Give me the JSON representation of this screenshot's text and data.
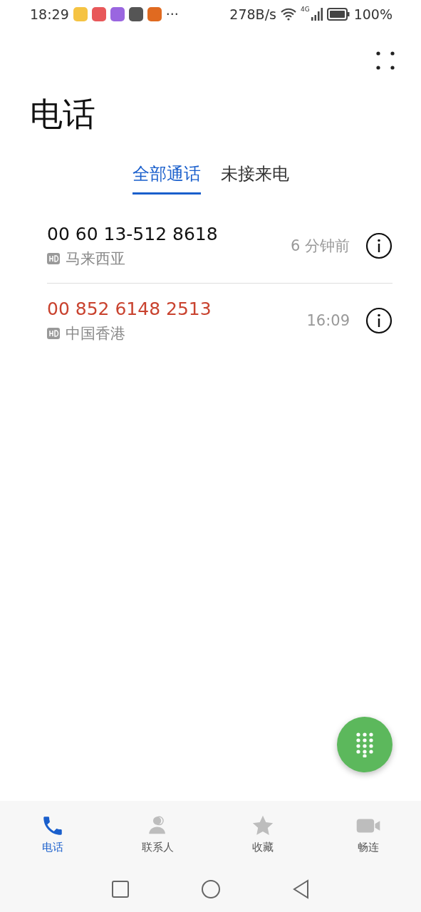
{
  "status_bar": {
    "time": "18:29",
    "notifications": [
      {
        "color": "#f5c343"
      },
      {
        "color": "#e8585a"
      },
      {
        "color": "#9a66e0"
      },
      {
        "color": "#555555"
      },
      {
        "color": "#e06a20"
      }
    ],
    "more": "···",
    "speed": "278B/s",
    "network": "4G",
    "battery": "100%"
  },
  "title": "电话",
  "tabs": [
    {
      "label": "全部通话",
      "selected": true
    },
    {
      "label": "未接来电",
      "selected": false
    }
  ],
  "calls": [
    {
      "number": "00 60 13-512 8618",
      "location": "马来西亚",
      "time": "6 分钟前",
      "missed": false
    },
    {
      "number": "00 852 6148 2513",
      "location": "中国香港",
      "time": "16:09",
      "missed": true
    }
  ],
  "nav": [
    {
      "kind": "phone",
      "label": "电话",
      "selected": true
    },
    {
      "kind": "contacts",
      "label": "联系人",
      "selected": false
    },
    {
      "kind": "favorites",
      "label": "收藏",
      "selected": false
    },
    {
      "kind": "video",
      "label": "畅连",
      "selected": false
    }
  ]
}
